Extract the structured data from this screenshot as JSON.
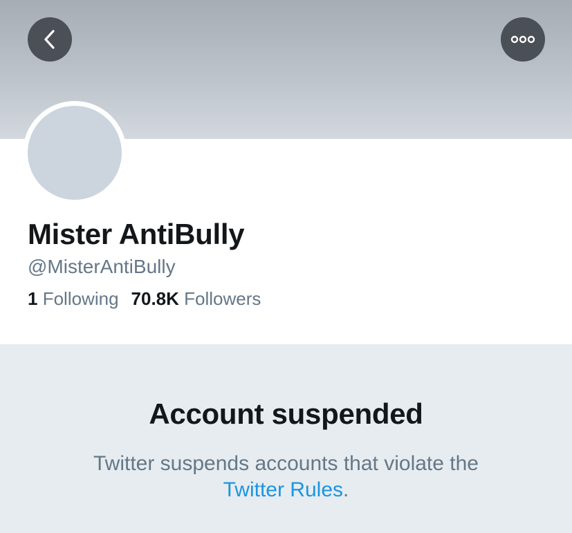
{
  "header": {
    "back_icon": "chevron-left-icon",
    "more_icon": "ellipsis-horizontal-icon"
  },
  "profile": {
    "display_name": "Mister AntiBully",
    "handle": "@MisterAntiBully",
    "following_count": "1",
    "following_label": "Following",
    "followers_count": "70.8K",
    "followers_label": "Followers"
  },
  "suspension": {
    "title": "Account suspended",
    "message": "Twitter suspends accounts that violate the",
    "link_text": "Twitter Rules",
    "trailing": "."
  },
  "colors": {
    "banner": "#b6bdc5",
    "button_bg": "#4b5056",
    "avatar_placeholder": "#ccd5de",
    "panel_bg": "#e6ecf0",
    "primary_text": "#14171a",
    "secondary_text": "#657786",
    "link": "#1b95e0"
  }
}
